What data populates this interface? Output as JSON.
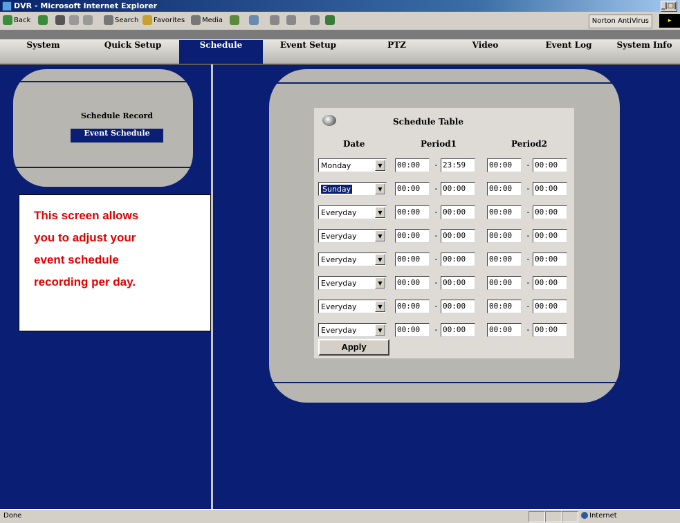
{
  "window": {
    "title": "DVR - Microsoft Internet Explorer",
    "controls": "_|□|"
  },
  "toolbar": {
    "back": "Back",
    "search": "Search",
    "favorites": "Favorites",
    "media": "Media",
    "norton": "Norton AntiVirus",
    "corner": "▸"
  },
  "nav": {
    "items": [
      "System",
      "Quick Setup",
      "Schedule",
      "Event Setup",
      "PTZ",
      "Video",
      "Event Log",
      "System Info"
    ],
    "active": "Schedule"
  },
  "left_menu": {
    "items": [
      "Schedule Record",
      "Event Schedule"
    ],
    "selected": "Event Schedule"
  },
  "info_box": {
    "lines": [
      "This screen allows",
      "you to adjust your",
      "event schedule",
      "recording per day."
    ]
  },
  "schedule": {
    "title": "Schedule Table",
    "headers": {
      "date": "Date",
      "period1": "Period1",
      "period2": "Period2"
    },
    "rows": [
      {
        "day": "Monday",
        "p1_start": "00:00",
        "p1_end": "23:59",
        "p2_start": "00:00",
        "p2_end": "00:00"
      },
      {
        "day": "Sunday",
        "p1_start": "00:00",
        "p1_end": "00:00",
        "p2_start": "00:00",
        "p2_end": "00:00",
        "highlighted": true
      },
      {
        "day": "Everyday",
        "p1_start": "00:00",
        "p1_end": "00:00",
        "p2_start": "00:00",
        "p2_end": "00:00"
      },
      {
        "day": "Everyday",
        "p1_start": "00:00",
        "p1_end": "00:00",
        "p2_start": "00:00",
        "p2_end": "00:00"
      },
      {
        "day": "Everyday",
        "p1_start": "00:00",
        "p1_end": "00:00",
        "p2_start": "00:00",
        "p2_end": "00:00"
      },
      {
        "day": "Everyday",
        "p1_start": "00:00",
        "p1_end": "00:00",
        "p2_start": "00:00",
        "p2_end": "00:00"
      },
      {
        "day": "Everyday",
        "p1_start": "00:00",
        "p1_end": "00:00",
        "p2_start": "00:00",
        "p2_end": "00:00"
      },
      {
        "day": "Everyday",
        "p1_start": "00:00",
        "p1_end": "00:00",
        "p2_start": "00:00",
        "p2_end": "00:00"
      }
    ],
    "apply_label": "Apply",
    "separator": "-"
  },
  "status": {
    "left": "Done",
    "zone": "Internet"
  },
  "colors": {
    "background": "#0a1f73",
    "panel": "#b8b6b0",
    "info_text": "#e00000"
  }
}
